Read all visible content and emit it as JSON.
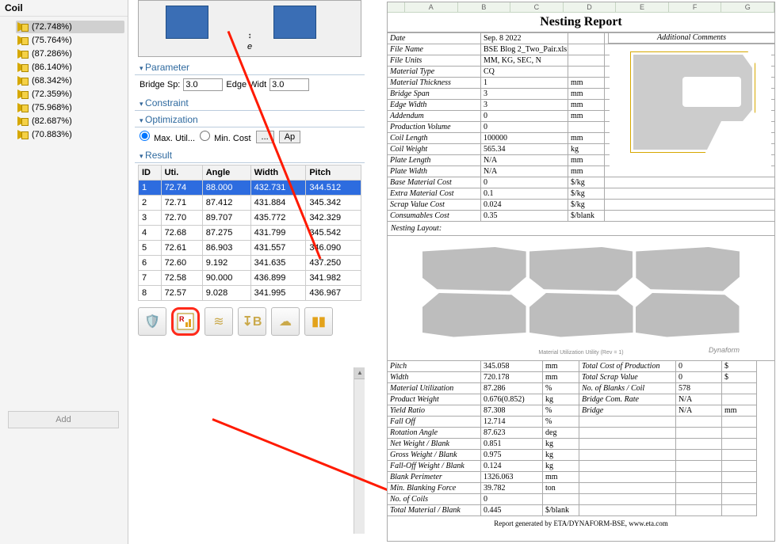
{
  "sidebar": {
    "header": "Coil",
    "items": [
      {
        "label": "(72.748%)",
        "selected": true
      },
      {
        "label": "(75.764%)"
      },
      {
        "label": "(87.286%)"
      },
      {
        "label": "(86.140%)"
      },
      {
        "label": "(68.342%)"
      },
      {
        "label": "(72.359%)"
      },
      {
        "label": "(75.968%)"
      },
      {
        "label": "(82.687%)"
      },
      {
        "label": "(70.883%)"
      }
    ],
    "add_label": "Add"
  },
  "panel": {
    "param_head": "Parameter",
    "bridge_label": "Bridge Sp:",
    "bridge_value": "3.0",
    "edge_label": "Edge Widt",
    "edge_value": "3.0",
    "constraint_head": "Constraint",
    "opt_head": "Optimization",
    "max_util_label": "Max. Util...",
    "min_cost_label": "Min. Cost",
    "more_btn": "...",
    "apply_btn": "Ap",
    "result_head": "Result",
    "preview_gap": "e",
    "columns": [
      "ID",
      "Uti.",
      "Angle",
      "Width",
      "Pitch"
    ],
    "rows": [
      {
        "id": "1",
        "uti": "72.74",
        "angle": "88.000",
        "width": "432.731",
        "pitch": "344.512",
        "sel": true
      },
      {
        "id": "2",
        "uti": "72.71",
        "angle": "87.412",
        "width": "431.884",
        "pitch": "345.342"
      },
      {
        "id": "3",
        "uti": "72.70",
        "angle": "89.707",
        "width": "435.772",
        "pitch": "342.329"
      },
      {
        "id": "4",
        "uti": "72.68",
        "angle": "87.275",
        "width": "431.799",
        "pitch": "345.542"
      },
      {
        "id": "5",
        "uti": "72.61",
        "angle": "86.903",
        "width": "431.557",
        "pitch": "346.090"
      },
      {
        "id": "6",
        "uti": "72.60",
        "angle": "9.192",
        "width": "341.635",
        "pitch": "437.250"
      },
      {
        "id": "7",
        "uti": "72.58",
        "angle": "90.000",
        "width": "436.899",
        "pitch": "341.982"
      },
      {
        "id": "8",
        "uti": "72.57",
        "angle": "9.028",
        "width": "341.995",
        "pitch": "436.967"
      }
    ],
    "tool_icons": {
      "tool1": "🛡️",
      "report": "R",
      "wave": "≋",
      "bend": "B",
      "cloud": "☁",
      "align": "▮▮"
    }
  },
  "sheet": {
    "cols": [
      "",
      "A",
      "B",
      "C",
      "D",
      "E",
      "F",
      "G"
    ],
    "title": "Nesting Report",
    "addl_comments": "Additional Comments",
    "info": [
      {
        "k": "Date",
        "v": "Sep. 8 2022",
        "u": ""
      },
      {
        "k": "File Name",
        "v": "BSE Blog 2_Two_Pair.xls",
        "u": ""
      },
      {
        "k": "File Units",
        "v": "MM, KG, SEC, N",
        "u": ""
      },
      {
        "k": "Material Type",
        "v": "CQ",
        "u": ""
      },
      {
        "k": "Material Thickness",
        "v": "1",
        "u": "mm"
      },
      {
        "k": "Bridge Span",
        "v": "3",
        "u": "mm"
      },
      {
        "k": "Edge Width",
        "v": "3",
        "u": "mm"
      },
      {
        "k": "Addendum",
        "v": "0",
        "u": "mm"
      },
      {
        "k": "Production Volume",
        "v": "0",
        "u": ""
      },
      {
        "k": "Coil Length",
        "v": "100000",
        "u": "mm"
      },
      {
        "k": "Coil Weight",
        "v": "565.34",
        "u": "kg"
      },
      {
        "k": "Plate Length",
        "v": "N/A",
        "u": "mm"
      },
      {
        "k": "Plate Width",
        "v": "N/A",
        "u": "mm"
      },
      {
        "k": "Base Material Cost",
        "v": "0",
        "u": "$/kg"
      },
      {
        "k": "Extra Material Cost",
        "v": "0.1",
        "u": "$/kg"
      },
      {
        "k": "Scrap Value Cost",
        "v": "0.024",
        "u": "$/kg"
      },
      {
        "k": "Consumables Cost",
        "v": "0.35",
        "u": "$/blank"
      }
    ],
    "nesting_label": "Nesting Layout:",
    "logo": "Dynaform",
    "axis_caption": "Material Utilization Utility (Rev = 1)",
    "bottom_rows": [
      {
        "k": "Pitch",
        "v": "345.058",
        "u": "mm",
        "k2": "Total Cost of Production",
        "v2": "0",
        "u2": "$"
      },
      {
        "k": "Width",
        "v": "720.178",
        "u": "mm",
        "k2": "Total Scrap Value",
        "v2": "0",
        "u2": "$"
      },
      {
        "k": "Material Utilization",
        "v": "87.286",
        "u": "%",
        "k2": "No. of Blanks / Coil",
        "v2": "578",
        "u2": ""
      },
      {
        "k": "Product Weight",
        "v": "0.676(0.852)",
        "u": "kg",
        "k2": "Bridge Com. Rate",
        "v2": "N/A",
        "u2": ""
      },
      {
        "k": "Yield Ratio",
        "v": "87.308",
        "u": "%",
        "k2": "Bridge",
        "v2": "N/A",
        "u2": "mm"
      },
      {
        "k": "Fall Off",
        "v": "12.714",
        "u": "%",
        "k2": "",
        "v2": "",
        "u2": ""
      },
      {
        "k": "Rotation Angle",
        "v": "87.623",
        "u": "deg",
        "k2": "",
        "v2": "",
        "u2": ""
      },
      {
        "k": "Net Weight / Blank",
        "v": "0.851",
        "u": "kg",
        "k2": "",
        "v2": "",
        "u2": ""
      },
      {
        "k": "Gross Weight / Blank",
        "v": "0.975",
        "u": "kg",
        "k2": "",
        "v2": "",
        "u2": ""
      },
      {
        "k": "Fall-Off Weight / Blank",
        "v": "0.124",
        "u": "kg",
        "k2": "",
        "v2": "",
        "u2": ""
      },
      {
        "k": "Blank Perimeter",
        "v": "1326.063",
        "u": "mm",
        "k2": "",
        "v2": "",
        "u2": ""
      },
      {
        "k": "Min. Blanking Force",
        "v": "39.782",
        "u": "ton",
        "k2": "",
        "v2": "",
        "u2": ""
      },
      {
        "k": "No. of Coils",
        "v": "0",
        "u": "",
        "k2": "",
        "v2": "",
        "u2": ""
      },
      {
        "k": "Total Material / Blank",
        "v": "0.445",
        "u": "$/blank",
        "k2": "",
        "v2": "",
        "u2": ""
      }
    ],
    "footer": "Report generated by ETA/DYNAFORM-BSE, www.eta.com"
  }
}
